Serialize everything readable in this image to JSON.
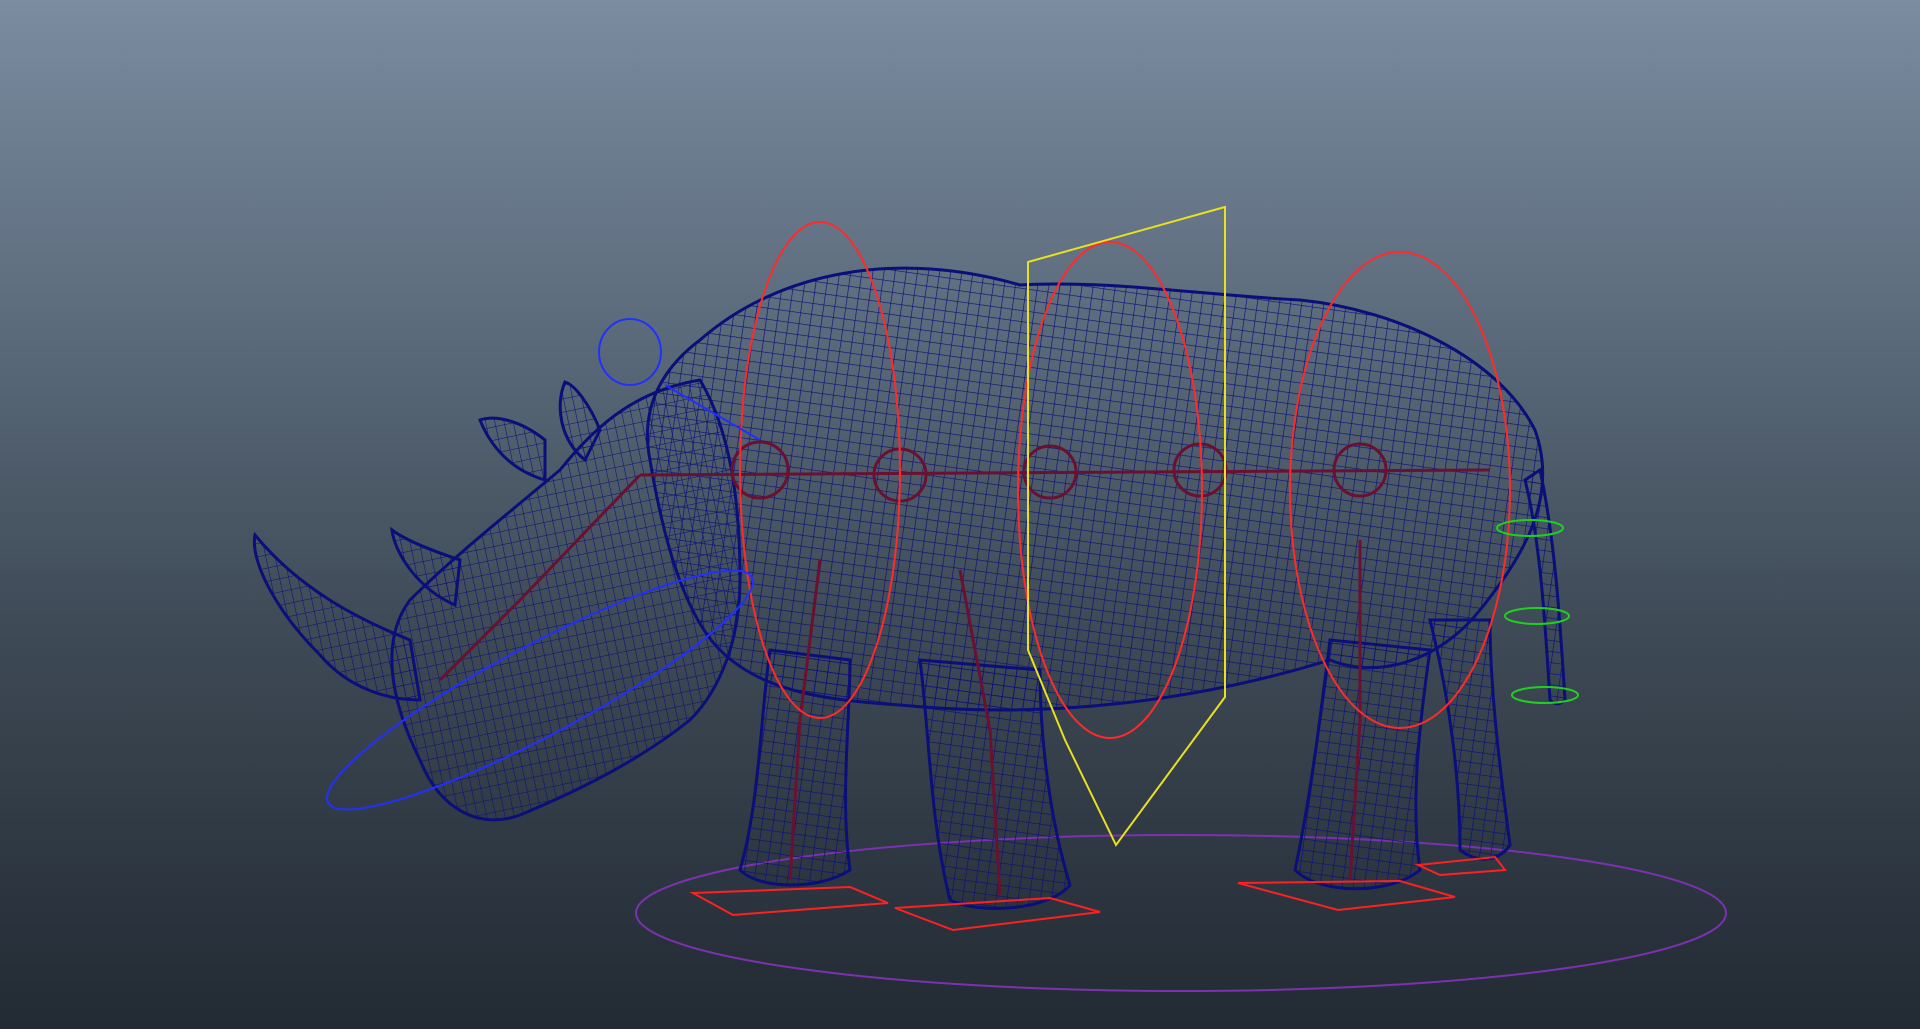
{
  "viewport": {
    "background_top": "#7b8ba0",
    "background_bottom": "#222a33"
  },
  "scene": {
    "model": "rhino-wireframe",
    "mesh_color": "#0a0f7a",
    "skeleton_color": "#6a1030",
    "controls": {
      "root_color": "#7a32b0",
      "spine_color": "#ff2a2a",
      "cog_color": "#e8e020",
      "head_color": "#2230ff",
      "tail_color": "#20d020",
      "foot_color": "#ff2020"
    }
  }
}
